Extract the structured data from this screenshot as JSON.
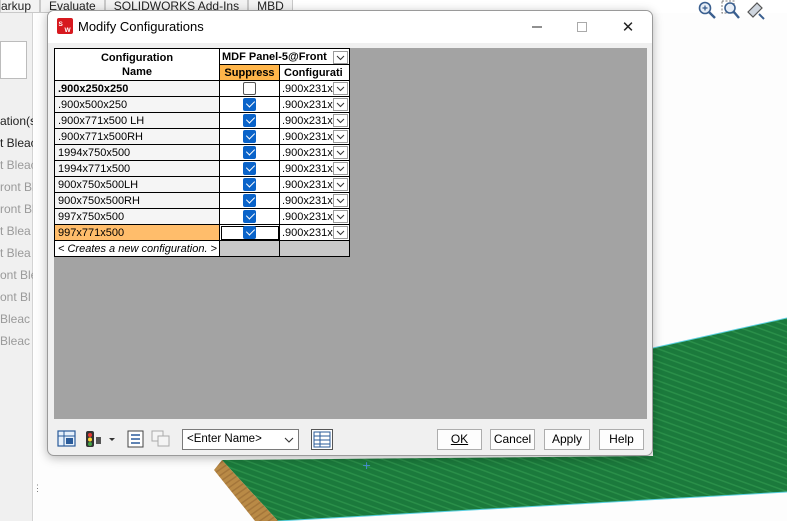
{
  "app_tabs": [
    "arkup",
    "Evaluate",
    "SOLIDWORKS Add-Ins",
    "MBD"
  ],
  "tree_items": [
    "ation(s",
    "t Bleac",
    "t Bleac",
    "ront Bl",
    "ront Bl",
    "t Blea",
    "t Blea",
    "ont Ble",
    "ont Bl",
    "Bleac",
    "Bleac"
  ],
  "dialog": {
    "title": "Modify Configurations",
    "close_symbol": "✕",
    "column_header": "Configuration Name",
    "component_header": "MDF Panel-5@Front",
    "subheaders": {
      "suppress": "Suppress",
      "configuration": "Configurati"
    },
    "rows": [
      {
        "name": ".900x250x250",
        "suppress": false,
        "configuration": ".900x231x",
        "bold": true
      },
      {
        "name": ".900x500x250",
        "suppress": true,
        "configuration": ".900x231x"
      },
      {
        "name": ".900x771x500 LH",
        "suppress": true,
        "configuration": ".900x231x"
      },
      {
        "name": ".900x771x500RH",
        "suppress": true,
        "configuration": ".900x231x"
      },
      {
        "name": "1994x750x500",
        "suppress": true,
        "configuration": ".900x231x"
      },
      {
        "name": "1994x771x500",
        "suppress": true,
        "configuration": ".900x231x"
      },
      {
        "name": "900x750x500LH",
        "suppress": true,
        "configuration": ".900x231x"
      },
      {
        "name": "900x750x500RH",
        "suppress": true,
        "configuration": ".900x231x"
      },
      {
        "name": "997x750x500",
        "suppress": true,
        "configuration": ".900x231x"
      },
      {
        "name": "997x771x500",
        "suppress": true,
        "configuration": ".900x231x",
        "selected": true
      }
    ],
    "create_row": "< Creates a new configuration. >",
    "name_select": {
      "value": "<Enter Name>"
    },
    "buttons": {
      "ok": "OK",
      "cancel": "Cancel",
      "apply": "Apply",
      "help": "Help"
    }
  },
  "colors": {
    "accent": "#0a63c9",
    "suppress_header": "#ffb54a",
    "selected_row": "#ffbd6b",
    "grid_bg": "#a3a3a3",
    "board_green": "#1b7a3c"
  }
}
